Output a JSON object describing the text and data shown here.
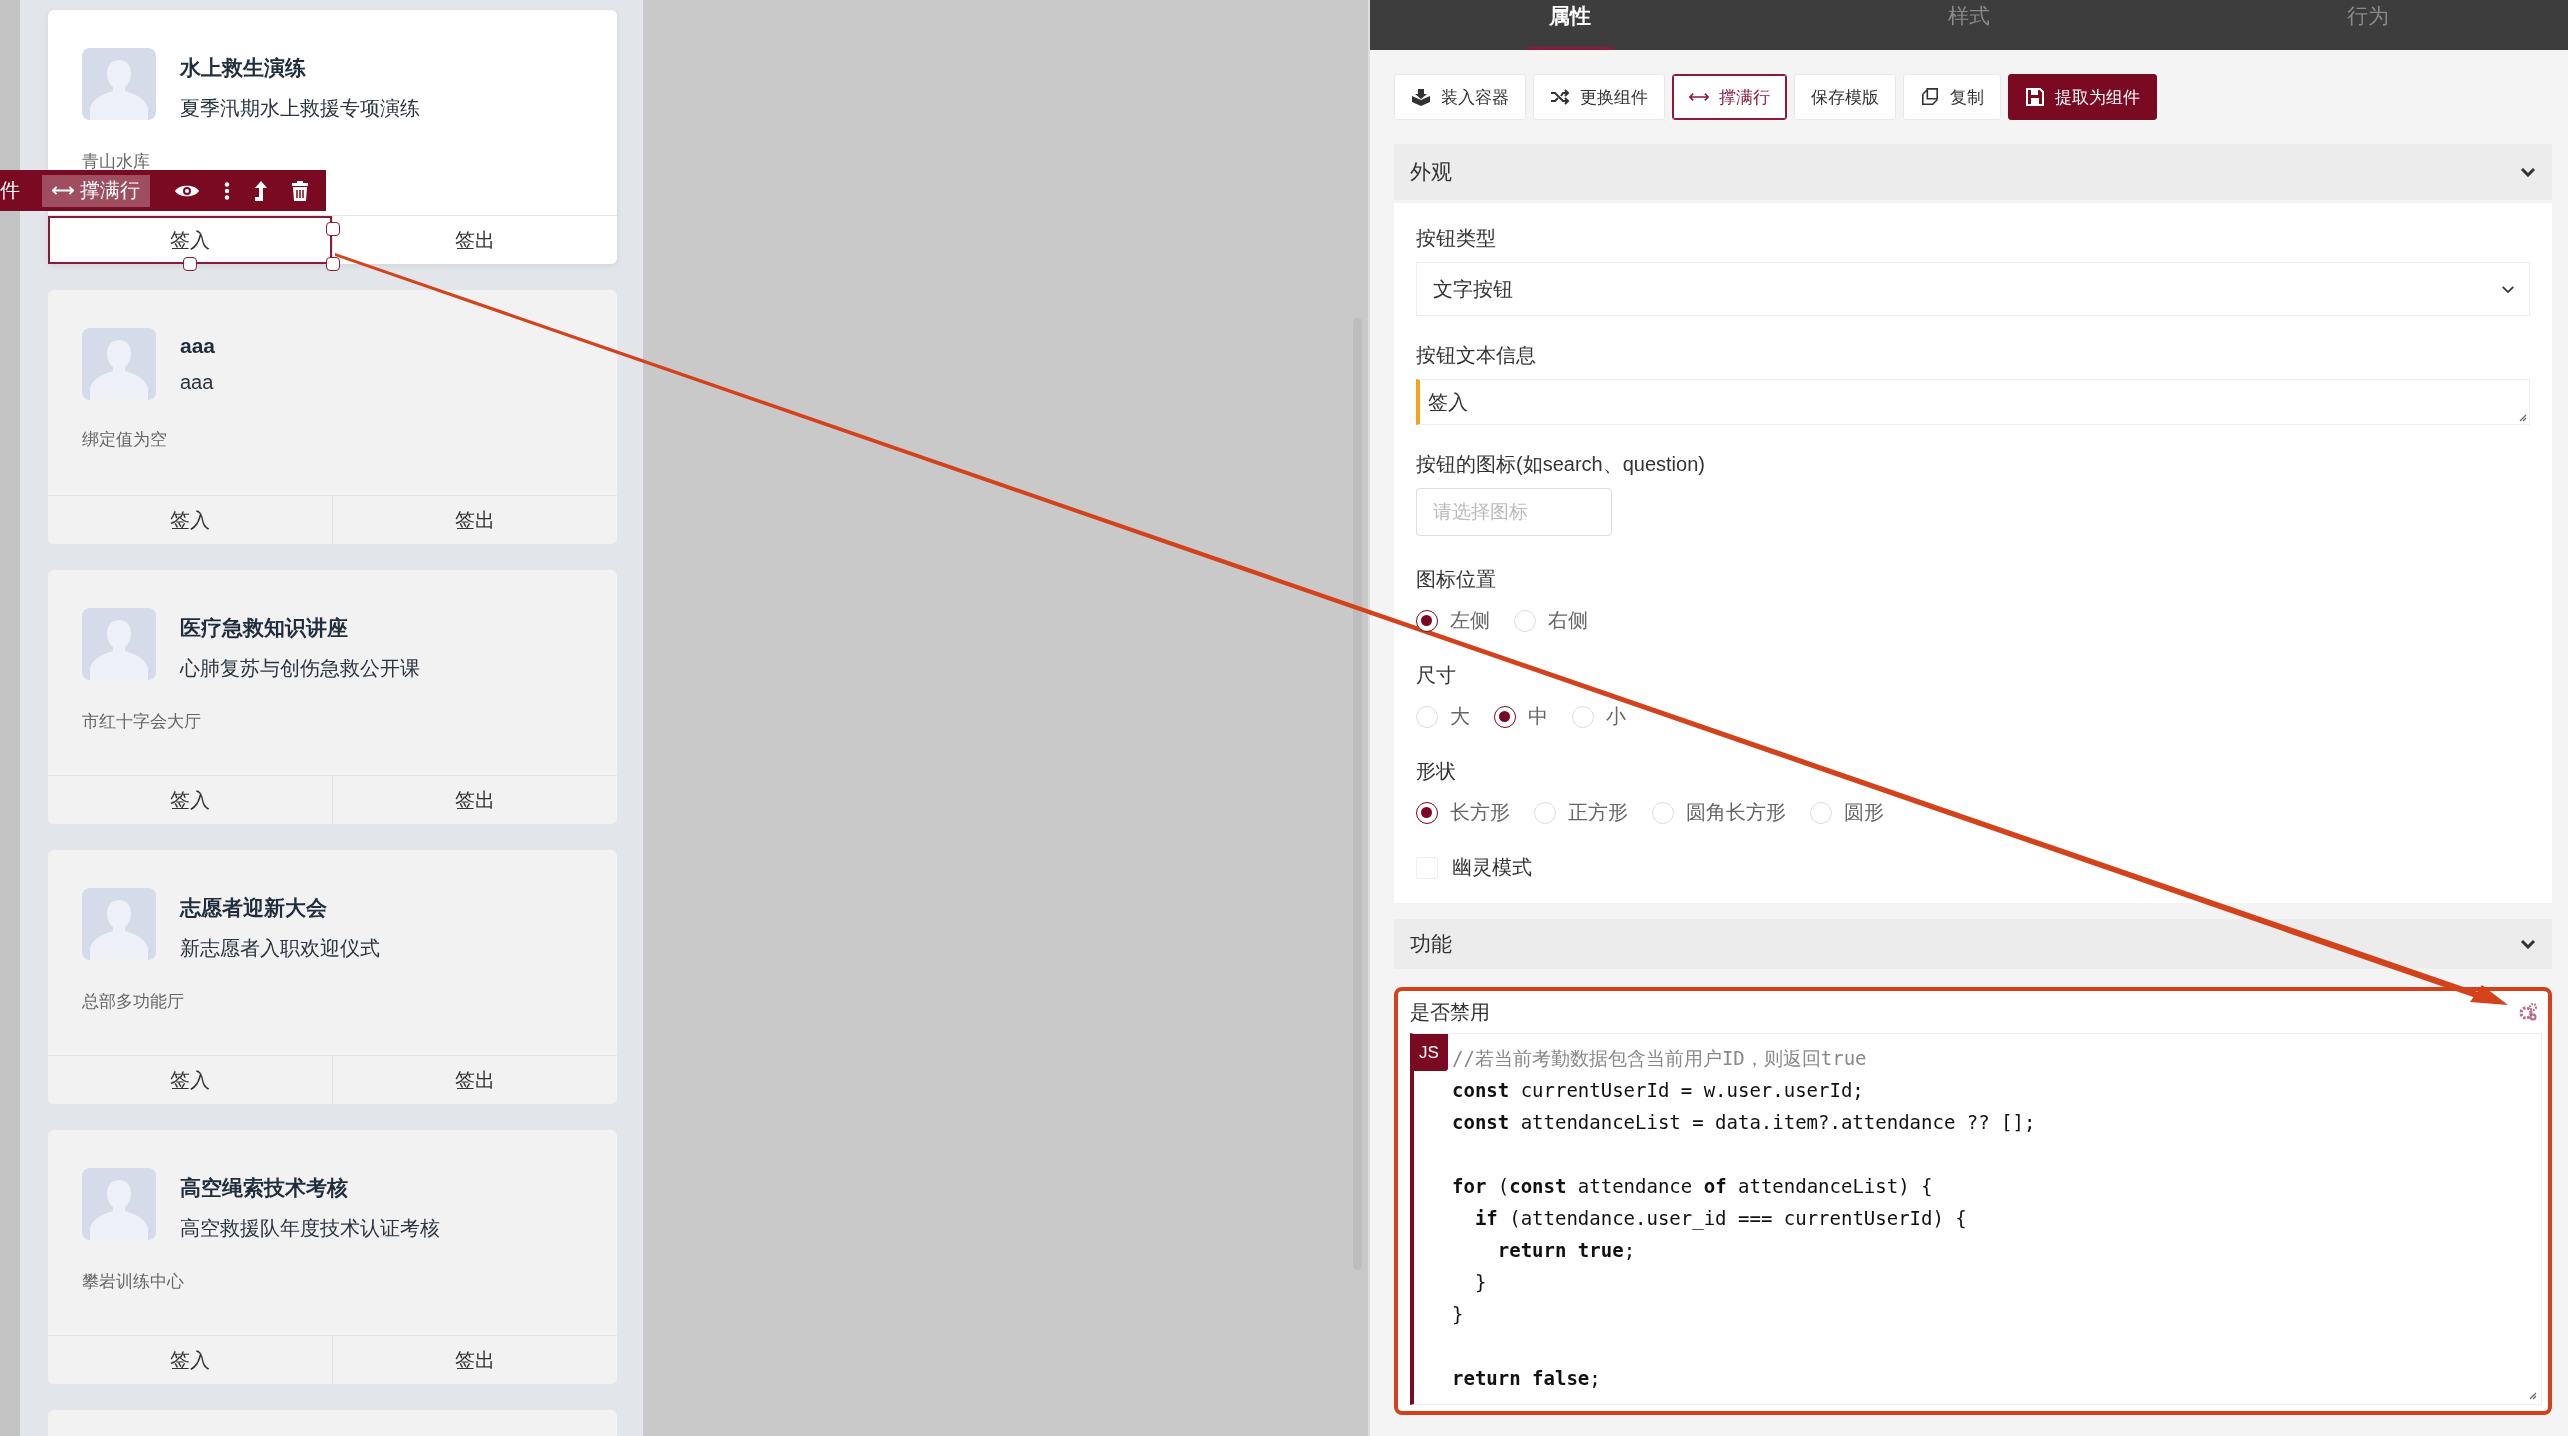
{
  "canvas": {
    "cards": [
      {
        "title": "水上救生演练",
        "subtitle": "夏季汛期水上救援专项演练",
        "location": "青山水库",
        "selected": true,
        "buttons": [
          {
            "label": "签入",
            "selected": true
          },
          {
            "label": "签出",
            "selected": false
          }
        ]
      },
      {
        "title": "aaa",
        "subtitle": "aaa",
        "location": "绑定值为空",
        "selected": false,
        "buttons": [
          {
            "label": "签入",
            "selected": false
          },
          {
            "label": "签出",
            "selected": false
          }
        ]
      },
      {
        "title": "医疗急救知识讲座",
        "subtitle": "心肺复苏与创伤急救公开课",
        "location": "市红十字会大厅",
        "selected": false,
        "buttons": [
          {
            "label": "签入",
            "selected": false
          },
          {
            "label": "签出",
            "selected": false
          }
        ]
      },
      {
        "title": "志愿者迎新大会",
        "subtitle": "新志愿者入职欢迎仪式",
        "location": "总部多功能厅",
        "selected": false,
        "buttons": [
          {
            "label": "签入",
            "selected": false
          },
          {
            "label": "签出",
            "selected": false
          }
        ]
      },
      {
        "title": "高空绳索技术考核",
        "subtitle": "高空救援队年度技术认证考核",
        "location": "攀岩训练中心",
        "selected": false,
        "buttons": [
          {
            "label": "签入",
            "selected": false
          },
          {
            "label": "签出",
            "selected": false
          }
        ]
      }
    ],
    "component_toolbar": {
      "label": "件",
      "fill_row": "撑满行"
    }
  },
  "panel": {
    "tabs": [
      {
        "label": "属性",
        "selected": true
      },
      {
        "label": "样式",
        "selected": false
      },
      {
        "label": "行为",
        "selected": false
      }
    ],
    "actions": [
      {
        "label": "装入容器",
        "kind": "default",
        "active": false
      },
      {
        "label": "更换组件",
        "kind": "default",
        "active": false
      },
      {
        "label": "撑满行",
        "kind": "default",
        "active": true
      },
      {
        "label": "保存模版",
        "kind": "default",
        "active": false
      },
      {
        "label": "复制",
        "kind": "default",
        "active": false
      },
      {
        "label": "提取为组件",
        "kind": "primary",
        "active": false
      }
    ],
    "appearance": {
      "title": "外观",
      "expanded": true,
      "button_type": {
        "label": "按钮类型",
        "value": "文字按钮"
      },
      "button_text": {
        "label": "按钮文本信息",
        "value": "签入"
      },
      "icon": {
        "label": "按钮的图标(如search、question)",
        "placeholder": "请选择图标"
      },
      "icon_position": {
        "label": "图标位置",
        "options": [
          {
            "label": "左侧",
            "selected": true
          },
          {
            "label": "右侧",
            "selected": false
          }
        ]
      },
      "size": {
        "label": "尺寸",
        "options": [
          {
            "label": "大",
            "selected": false
          },
          {
            "label": "中",
            "selected": true
          },
          {
            "label": "小",
            "selected": false
          }
        ]
      },
      "shape": {
        "label": "形状",
        "options": [
          {
            "label": "长方形",
            "selected": true
          },
          {
            "label": "正方形",
            "selected": false
          },
          {
            "label": "圆角长方形",
            "selected": false
          },
          {
            "label": "圆形",
            "selected": false
          }
        ]
      },
      "ghost_mode": {
        "label": "幽灵模式",
        "checked": false
      }
    },
    "function": {
      "title": "功能",
      "expanded": true,
      "disabled_rule": {
        "label": "是否禁用",
        "badge": "JS",
        "lines": [
          {
            "kind": "comment",
            "text": "//若当前考勤数据包含当前用户ID，则返回true"
          },
          {
            "kind": "code",
            "text": "**const** currentUserId = w.user.userId;"
          },
          {
            "kind": "code",
            "text": "**const** attendanceList = data.item?.attendance ?? [];"
          },
          {
            "kind": "blank"
          },
          {
            "kind": "code",
            "text": "**for** (**const** attendance **of** attendanceList) {"
          },
          {
            "kind": "code",
            "text": "  **if** (attendance.user_id === currentUserId) {"
          },
          {
            "kind": "code",
            "text": "    **return** **true**;"
          },
          {
            "kind": "code",
            "text": "  }"
          },
          {
            "kind": "code",
            "text": "}"
          },
          {
            "kind": "blank"
          },
          {
            "kind": "code",
            "text": "**return** **false**;"
          }
        ]
      }
    }
  }
}
